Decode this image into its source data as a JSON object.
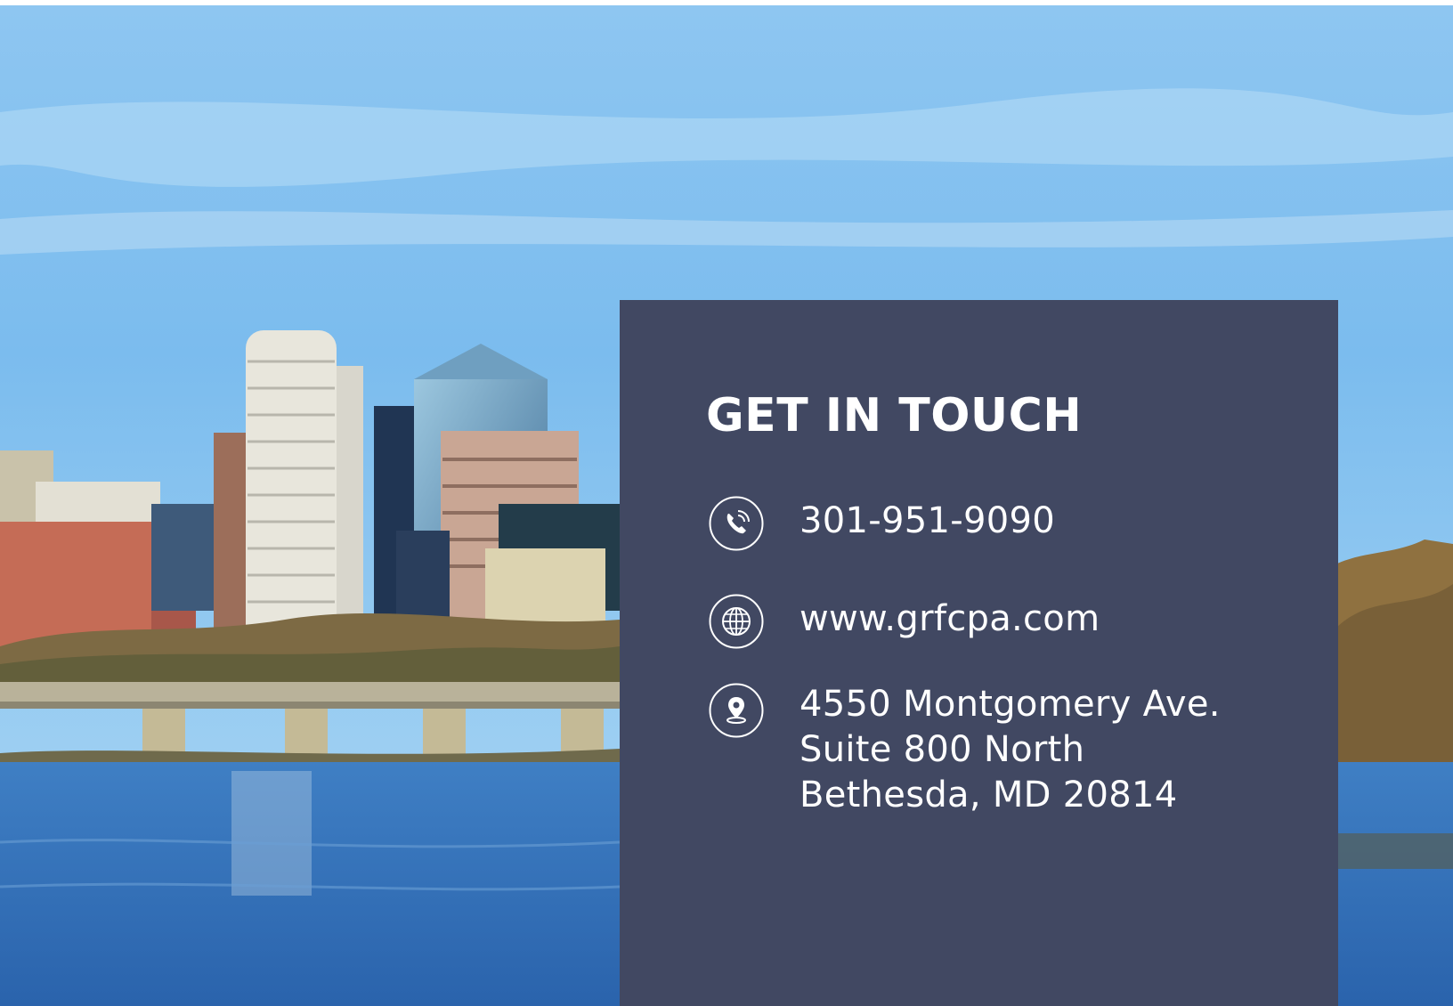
{
  "contact": {
    "title": "GET IN TOUCH",
    "phone": "301-951-9090",
    "website": "www.grfcpa.com",
    "address": {
      "line1": "4550 Montgomery Ave.",
      "line2": "Suite 800 North",
      "line3": "Bethesda, MD 20814"
    }
  },
  "icons": {
    "phone": "phone-icon",
    "website": "globe-icon",
    "address": "location-pin-icon"
  },
  "colors": {
    "card_background": "#414862",
    "text": "#ffffff",
    "sky": "#7dbdf0",
    "water": "#2f6ab4"
  }
}
